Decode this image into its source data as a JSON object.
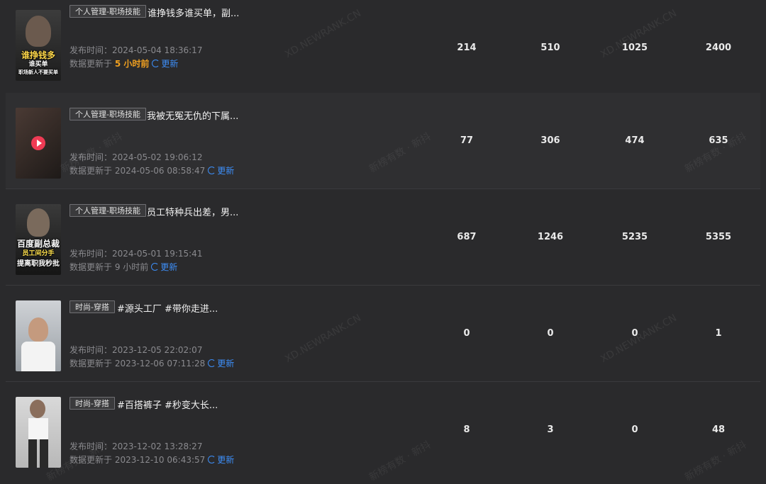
{
  "rows": [
    {
      "tag": "个人管理-职场技能",
      "title": "谁挣钱多谁买单，副...",
      "published": "发布时间：2024-05-04 18:36:17",
      "updated_prefix": "数据更新于 ",
      "updated_time": "5 小时前",
      "refresh_label": "更新",
      "thumb_caption": [
        "谁挣钱多",
        "谁买单",
        "职场新人不要买单"
      ],
      "metrics": [
        "214",
        "510",
        "1025",
        "2400"
      ]
    },
    {
      "tag": "个人管理-职场技能",
      "title": "我被无冤无仇的下属...",
      "published": "发布时间：2024-05-02 19:06:12",
      "updated_prefix": "数据更新于 ",
      "updated_time": "2024-05-06 08:58:47",
      "refresh_label": "更新",
      "thumb_caption": [],
      "metrics": [
        "77",
        "306",
        "474",
        "635"
      ]
    },
    {
      "tag": "个人管理-职场技能",
      "title": "员工特种兵出差，男...",
      "published": "发布时间：2024-05-01 19:15:41",
      "updated_prefix": "数据更新于 ",
      "updated_time": "9 小时前",
      "refresh_label": "更新",
      "thumb_caption": [
        "百度副总裁",
        "员工间分手",
        "提离职我秒批"
      ],
      "metrics": [
        "687",
        "1246",
        "5235",
        "5355"
      ]
    },
    {
      "tag": "时尚-穿搭",
      "title": "#源头工厂 #带你走进...",
      "published": "发布时间：2023-12-05 22:02:07",
      "updated_prefix": "数据更新于 ",
      "updated_time": "2023-12-06 07:11:28",
      "refresh_label": "更新",
      "thumb_caption": [],
      "metrics": [
        "0",
        "0",
        "0",
        "1"
      ]
    },
    {
      "tag": "时尚-穿搭",
      "title": "#百搭裤子 #秒变大长...",
      "published": "发布时间：2023-12-02 13:28:27",
      "updated_prefix": "数据更新于 ",
      "updated_time": "2023-12-10 06:43:57",
      "refresh_label": "更新",
      "thumb_caption": [],
      "metrics": [
        "8",
        "3",
        "0",
        "48"
      ]
    }
  ],
  "watermarks": {
    "domain": "XD.NEWRANK.CN",
    "brand": "新榜有数 · 新抖"
  },
  "colors": {
    "background": "#2a2a2c",
    "accent_blue": "#3d8ef7",
    "accent_orange": "#f0a020"
  }
}
